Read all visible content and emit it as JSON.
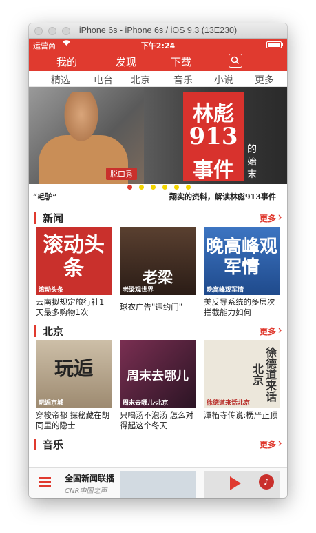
{
  "window": {
    "title": "iPhone 6s - iPhone 6s / iOS 9.3 (13E230)"
  },
  "status": {
    "carrier": "运营商",
    "wifi_icon": "wifi-icon",
    "time": "下午2:24",
    "battery_level": 1.0
  },
  "nav": {
    "tabs": [
      "我的",
      "发现",
      "下载"
    ],
    "search_icon": "search-icon"
  },
  "categories": [
    "精选",
    "电台",
    "北京",
    "音乐",
    "小说",
    "更多"
  ],
  "banner": {
    "tag": "脱口秀",
    "poster_lines": [
      "林彪",
      "913",
      "事件"
    ],
    "side_text": "的始末",
    "caption_left": "“毛驴”",
    "caption_right": "翔实的资料，解读林彪913事件",
    "page_count": 6,
    "active_page": 0
  },
  "sections": [
    {
      "name": "新闻",
      "more": "更多",
      "items": [
        {
          "thumb_big": "滚动头条",
          "thumb_small": "滚动头条",
          "title": "云南拟规定旅行社1天最多购物1次",
          "bg": "#c9302c"
        },
        {
          "thumb_big": "老梁",
          "thumb_small": "老梁观世界",
          "title": "球衣广告\"违约门\"",
          "bg": "#3a2a22"
        },
        {
          "thumb_big": "晚高峰观军情",
          "thumb_small": "晚高峰观军情",
          "title": "美反导系统的多层次拦截能力如何",
          "bg": "#2c5fa8"
        }
      ]
    },
    {
      "name": "北京",
      "more": "更多",
      "items": [
        {
          "thumb_big": "玩逅",
          "thumb_small": "玩逅京城",
          "title": "穿梭帝都 探秘藏在胡同里的隐士",
          "bg": "#b9a58c"
        },
        {
          "thumb_big": "周末去哪儿",
          "thumb_small": "周末去哪儿·北京",
          "title": "只喝汤不泡汤 怎么对得起这个冬天",
          "bg": "#5a2340"
        },
        {
          "thumb_big": "徐德道来话北京",
          "thumb_small": "徐德道来话北京",
          "title": "潭柘寺传说:楞严正顶",
          "bg": "#e9e4d8"
        }
      ]
    },
    {
      "name": "音乐",
      "more": "更多",
      "items": []
    }
  ],
  "player": {
    "now_title": "全国新闻联播",
    "now_sub": "CNR中国之声",
    "menu_icon": "menu-icon",
    "play_icon": "play-icon",
    "music_icon": "music-icon"
  }
}
